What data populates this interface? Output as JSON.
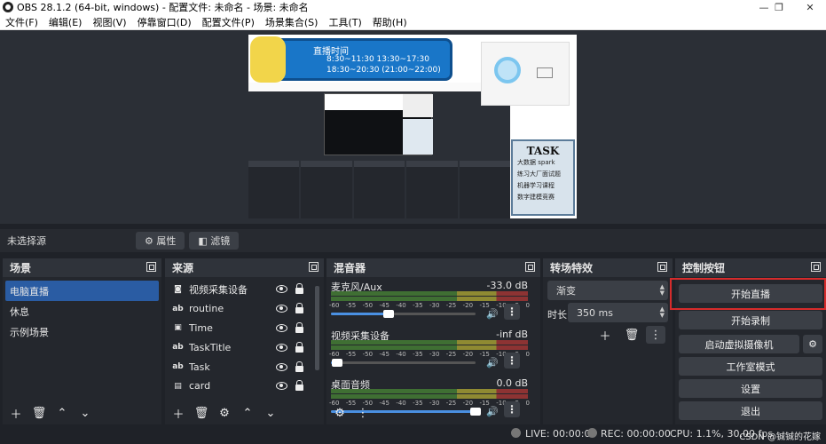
{
  "window": {
    "title": "OBS 28.1.2 (64-bit, windows) - 配置文件: 未命名 - 场景: 未命名",
    "min": "—",
    "max": "❐",
    "close": "✕"
  },
  "menu": [
    "文件(F)",
    "编辑(E)",
    "视图(V)",
    "停靠窗口(D)",
    "配置文件(P)",
    "场景集合(S)",
    "工具(T)",
    "帮助(H)"
  ],
  "preview": {
    "banner_title": "直播时间",
    "banner_line1": "8:30~11:30     13:30~17:30",
    "banner_line2": "18:30~20:30    (21:00~22:00)",
    "task_title": "TASK",
    "task_lines": [
      "大数据 spark",
      "练习大厂面试题",
      "机器学习课程",
      "数字建模竞赛"
    ]
  },
  "sourcebar": {
    "none_selected": "未选择源",
    "properties": "属性",
    "filters": "滤镜"
  },
  "scenes": {
    "title": "场景",
    "items": [
      "电脑直播",
      "休息",
      "示例场景"
    ],
    "selected": "电脑直播"
  },
  "sources": {
    "title": "来源",
    "items": [
      {
        "icon": "camera-icon",
        "glyph": "◙",
        "name": "视频采集设备"
      },
      {
        "icon": "text-icon",
        "glyph": "ab",
        "name": "routine"
      },
      {
        "icon": "image-icon",
        "glyph": "▣",
        "name": "Time"
      },
      {
        "icon": "text-icon",
        "glyph": "ab",
        "name": "TaskTitle"
      },
      {
        "icon": "text-icon",
        "glyph": "ab",
        "name": "Task"
      },
      {
        "icon": "card-icon",
        "glyph": "▤",
        "name": "card"
      }
    ]
  },
  "mixer": {
    "title": "混音器",
    "ticks": [
      "-60",
      "-55",
      "-50",
      "-45",
      "-40",
      "-35",
      "-30",
      "-25",
      "-20",
      "-15",
      "-10",
      "-5",
      "0"
    ],
    "channels": [
      {
        "name": "麦克风/Aux",
        "db": "-33.0 dB",
        "volume": 0.4
      },
      {
        "name": "视频采集设备",
        "db": "-inf dB",
        "volume": 0.04
      },
      {
        "name": "桌面音频",
        "db": "0.0 dB",
        "volume": 1.0
      }
    ]
  },
  "transitions": {
    "title": "转场特效",
    "selected": "渐变",
    "duration_label": "时长",
    "duration_value": "350 ms"
  },
  "controls": {
    "title": "控制按钮",
    "start_stream": "开始直播",
    "start_record": "开始录制",
    "virtual_cam": "启动虚拟摄像机",
    "studio_mode": "工作室模式",
    "settings": "设置",
    "exit": "退出"
  },
  "status": {
    "live": "LIVE: 00:00:00",
    "rec": "REC: 00:00:00",
    "cpu": "CPU: 1.1%, 30.00 fps"
  },
  "watermark": "CSDN @铖铖的花嫁",
  "colors": {
    "accent": "#2a5ca3",
    "highlight": "#d62b2b"
  }
}
